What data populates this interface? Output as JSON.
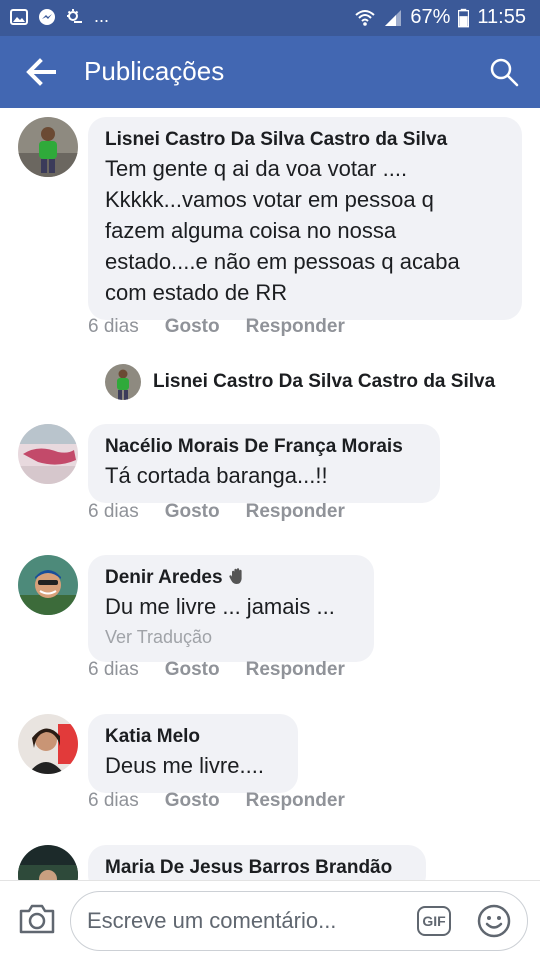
{
  "status_bar": {
    "battery": "67%",
    "time": "11:55",
    "dots": "..."
  },
  "header": {
    "title": "Publicações"
  },
  "comments": [
    {
      "name": "Lisnei Castro Da Silva Castro da Silva",
      "text": "Tem gente q ai da voa votar ....\nKkkkk...vamos votar em pessoa q\nfazem alguma coisa no nossa\nestado....e não em pessoas q acaba\ncom estado de RR",
      "time": "6 dias",
      "like": "Gosto",
      "reply": "Responder"
    },
    {
      "name": "Nacélio Morais De França Morais",
      "text": "Tá cortada baranga...!!",
      "time": "6 dias",
      "like": "Gosto",
      "reply": "Responder"
    },
    {
      "name": "Denir Aredes",
      "text": "Du me livre ... jamais ...",
      "translate": "Ver Tradução",
      "time": "6 dias",
      "like": "Gosto",
      "reply": "Responder"
    },
    {
      "name": "Katia Melo",
      "text": "Deus me livre....",
      "time": "6 dias",
      "like": "Gosto",
      "reply": "Responder"
    },
    {
      "name": "Maria De Jesus Barros Brandão"
    }
  ],
  "reply_preview": {
    "name": "Lisnei Castro Da Silva Castro da Silva"
  },
  "composer": {
    "placeholder": "Escreve um comentário...",
    "gif_label": "GIF"
  },
  "colors": {
    "statusbar": "#3b5998",
    "appbar": "#4267b2",
    "bubble": "#f1f2f6",
    "meta": "#909399"
  }
}
